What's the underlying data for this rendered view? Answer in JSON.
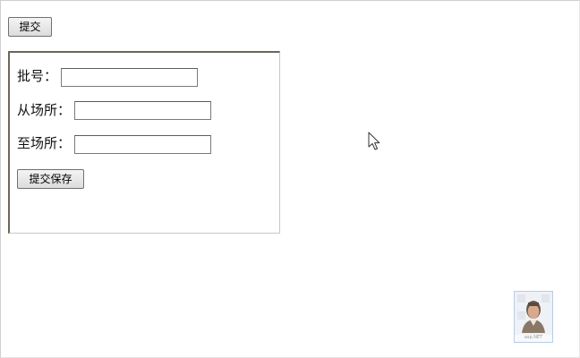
{
  "toolbar": {
    "submit_label": "提交"
  },
  "form": {
    "batch_label": "批号：",
    "batch_value": "",
    "from_label": "从场所：",
    "from_value": "",
    "to_label": "至场所：",
    "to_value": "",
    "save_label": "提交保存"
  },
  "thumbnail": {
    "caption": "asp.NET",
    "icon": "person-photo-icon"
  },
  "cursor": {
    "icon": "mouse-pointer-icon"
  }
}
